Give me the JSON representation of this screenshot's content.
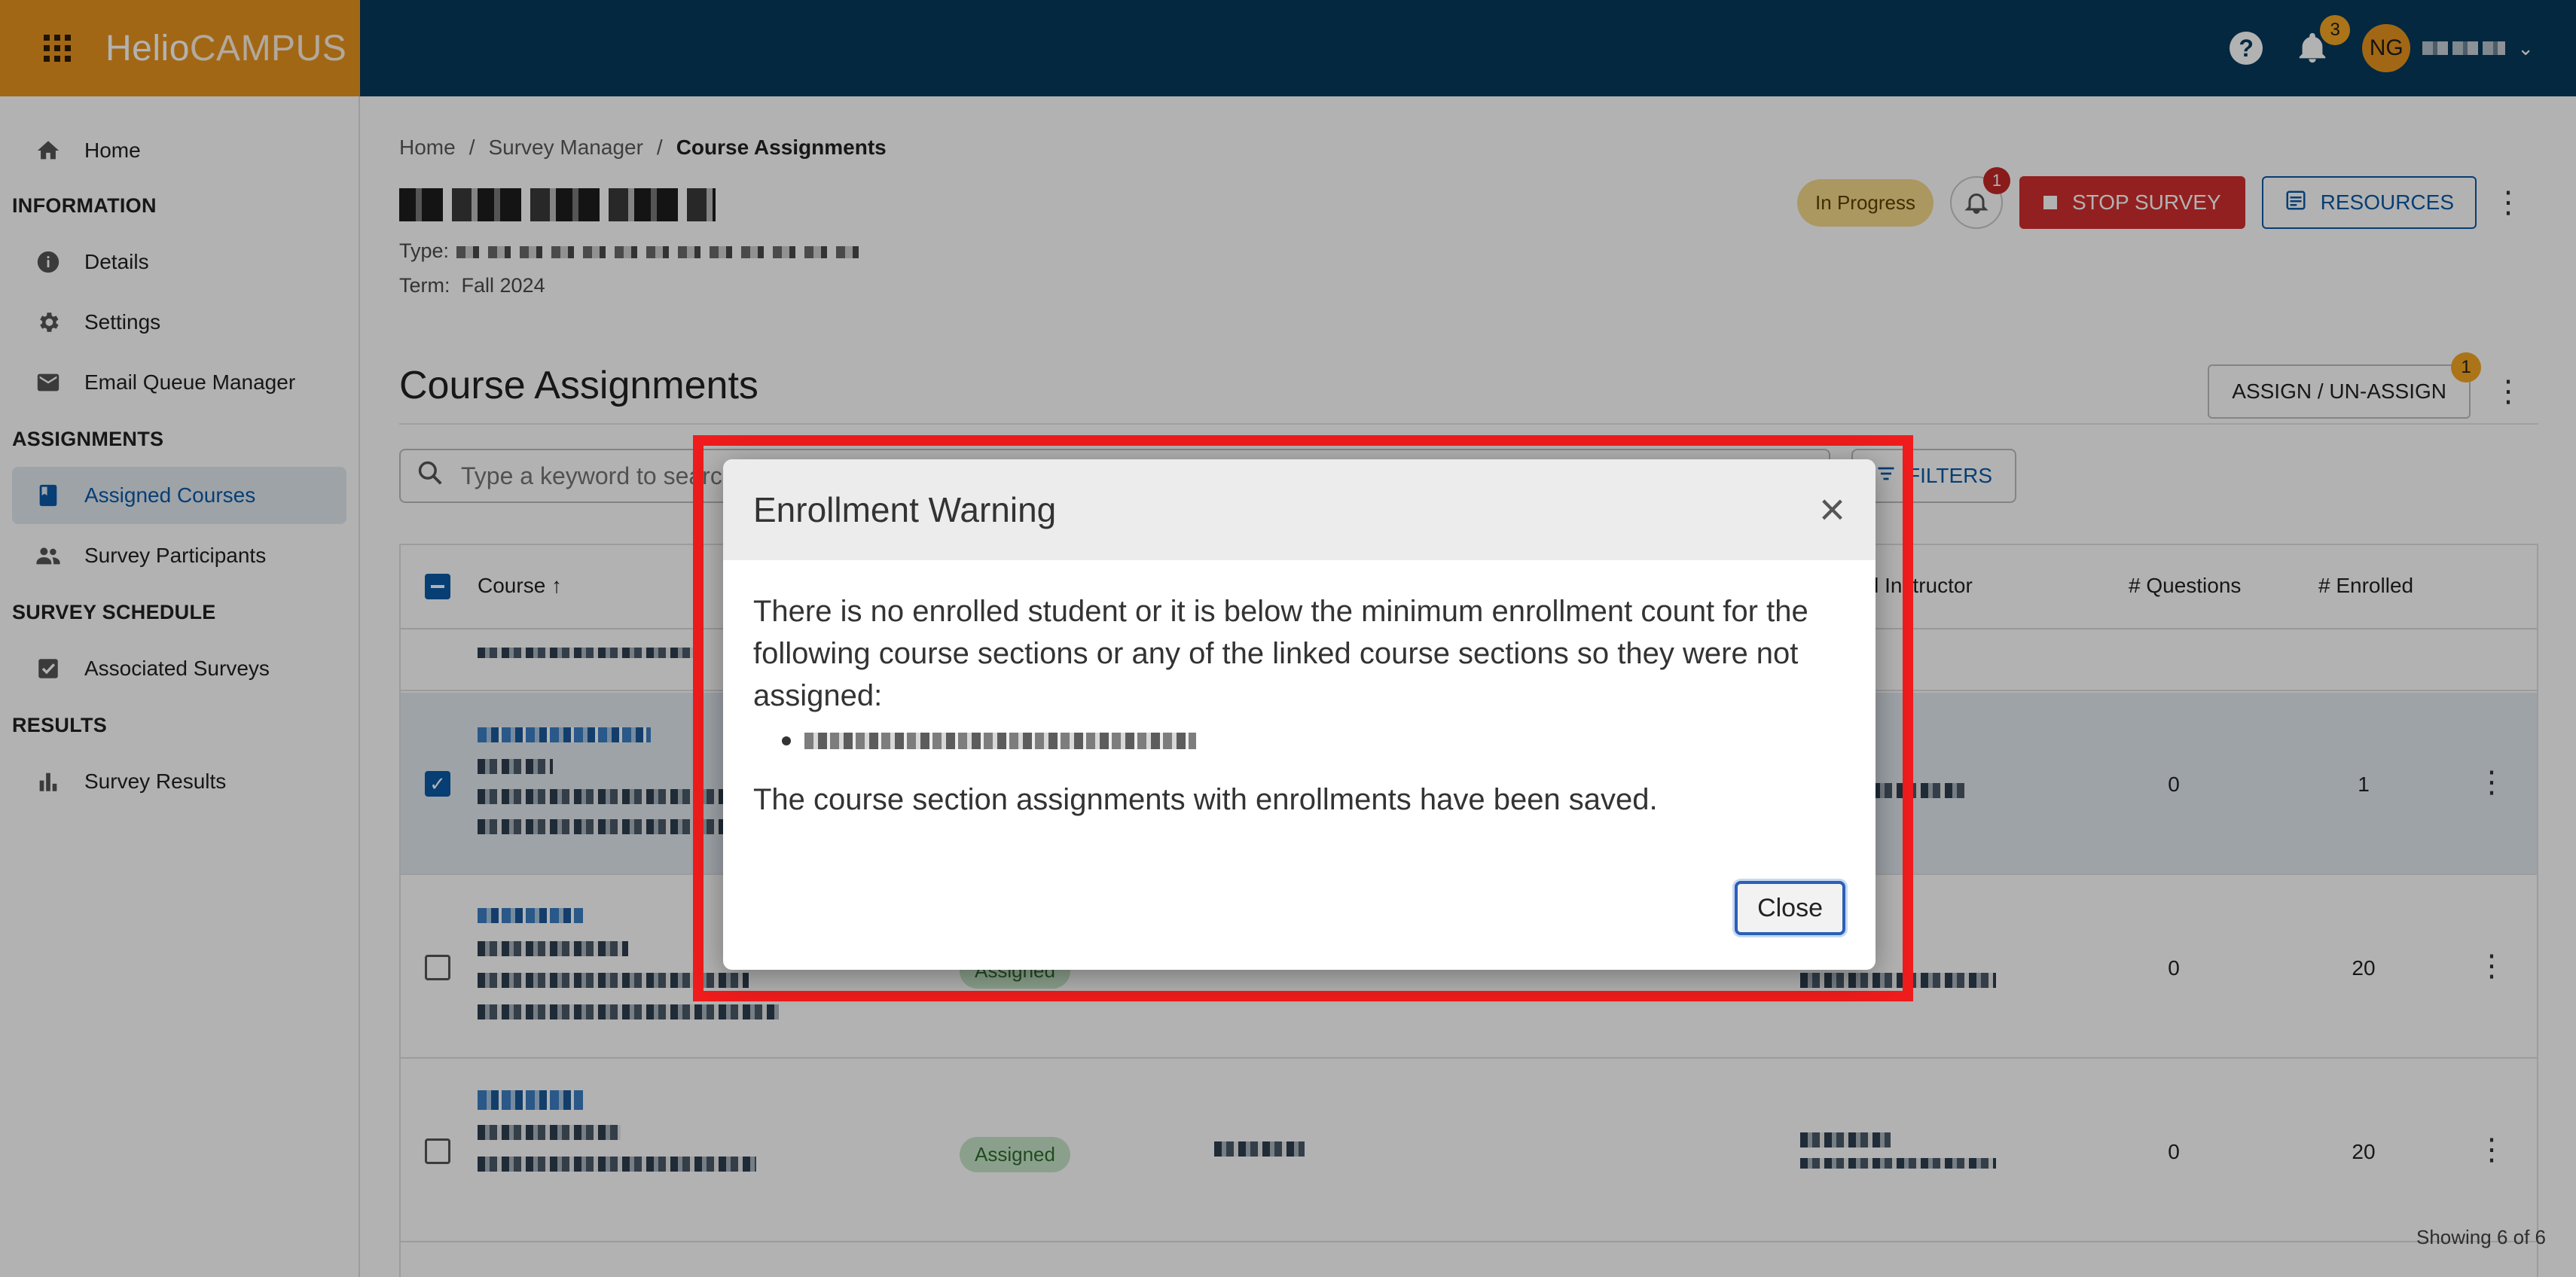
{
  "app": {
    "logo_part1": "Helio",
    "logo_part2": "CAMPUS",
    "notification_count": "3",
    "user_initials": "NG"
  },
  "sidebar": {
    "home": "Home",
    "section_information": "INFORMATION",
    "details": "Details",
    "settings": "Settings",
    "email_queue": "Email Queue Manager",
    "section_assignments": "ASSIGNMENTS",
    "assigned_courses": "Assigned Courses",
    "survey_participants": "Survey Participants",
    "section_schedule": "SURVEY SCHEDULE",
    "associated_surveys": "Associated Surveys",
    "section_results": "RESULTS",
    "survey_results": "Survey Results"
  },
  "breadcrumb": {
    "home": "Home",
    "sep": "/",
    "survey_manager": "Survey Manager",
    "current": "Course Assignments"
  },
  "survey": {
    "type_label": "Type:",
    "term_label": "Term:",
    "term_value": "Fall 2024",
    "status": "In Progress",
    "bell_count": "1",
    "stop_label": "STOP SURVEY",
    "resources_label": "RESOURCES"
  },
  "assignments": {
    "title": "Course Assignments",
    "assign_label": "ASSIGN / UN-ASSIGN",
    "assign_badge": "1",
    "search_placeholder": "Type a keyword to search",
    "filters_label": "FILTERS"
  },
  "table": {
    "col_course": "Course",
    "col_instructor": "Lead Instructor",
    "col_questions": "# Questions",
    "col_enrolled": "# Enrolled",
    "rows": [
      {
        "questions": "0",
        "enrolled": "1",
        "status": ""
      },
      {
        "questions": "0",
        "enrolled": "20",
        "status": "Assigned"
      },
      {
        "questions": "0",
        "enrolled": "20",
        "status": "Assigned"
      }
    ],
    "showing": "Showing 6 of 6"
  },
  "modal": {
    "title": "Enrollment Warning",
    "close_x": "×",
    "message": "There is no enrolled student or it is below the minimum enrollment count for the following course sections or any of the linked course sections so they were not assigned:",
    "saved_message": "The course section assignments with enrollments have been saved.",
    "close_label": "Close"
  },
  "colors": {
    "topbar": "#053a5c",
    "brand": "#e9941f",
    "accent_blue": "#0b5aa6",
    "stop_red": "#d32f2f",
    "highlight_frame": "#ee1c1c"
  }
}
